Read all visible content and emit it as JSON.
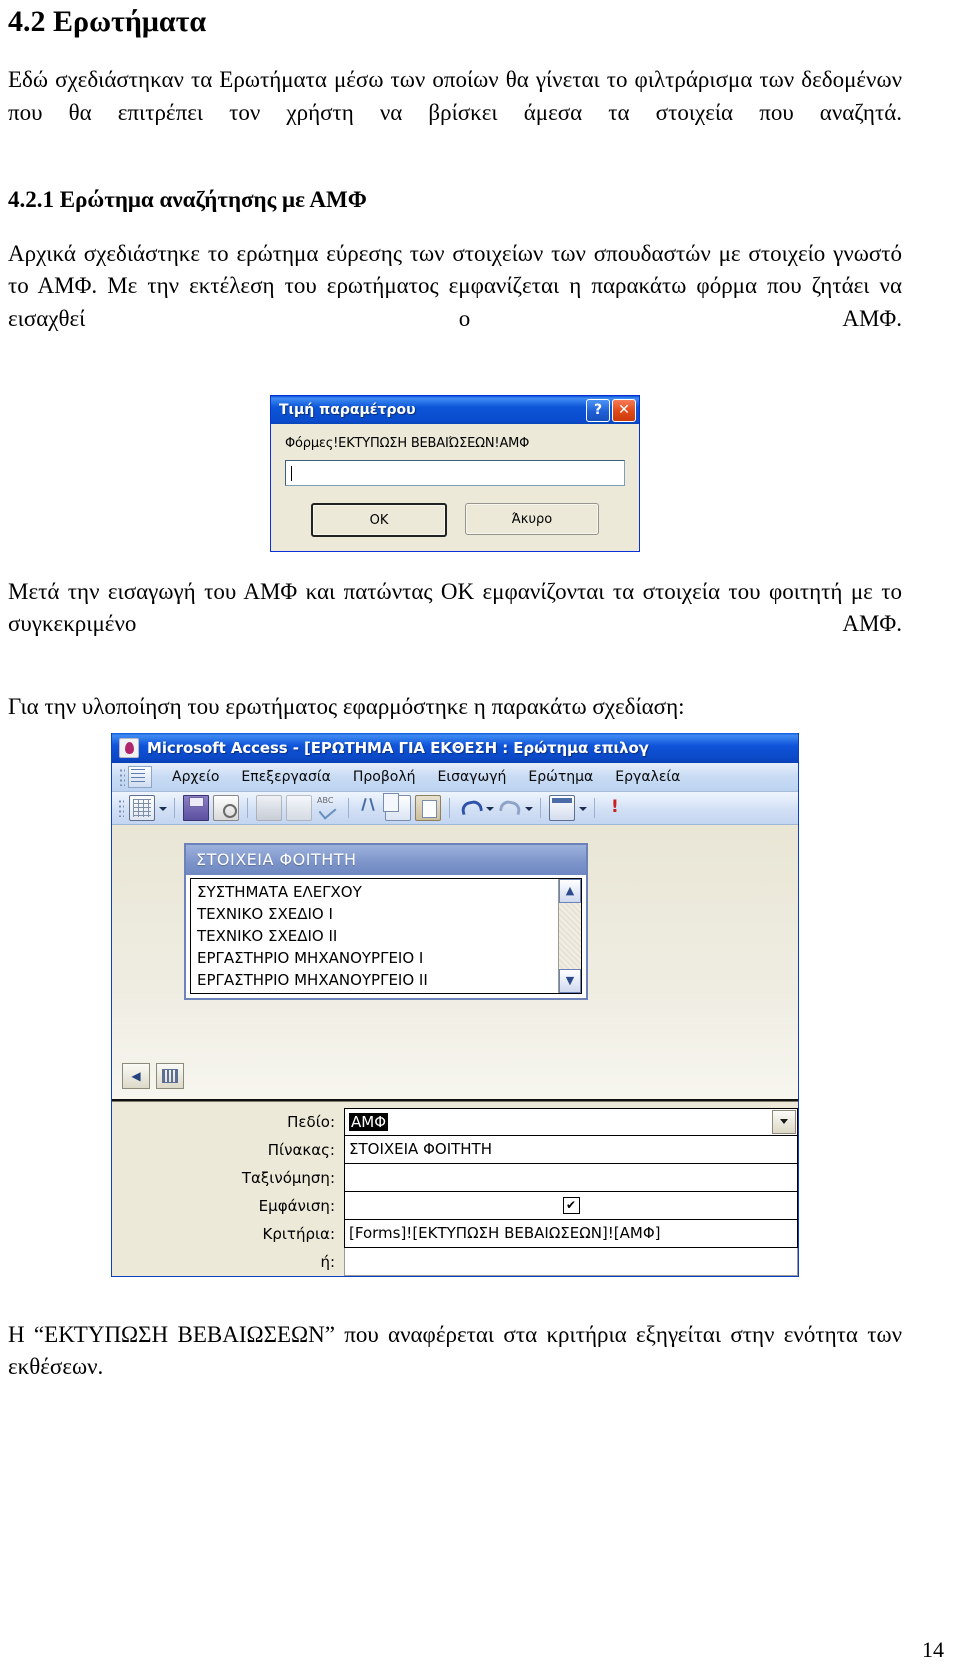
{
  "document": {
    "heading": "4.2 Ερωτήματα",
    "intro_paragraph": "Εδώ σχεδιάστηκαν τα Ερωτήματα μέσω των οποίων θα γίνεται το φιλτράρισμα των δεδομένων που θα επιτρέπει τον χρήστη να βρίσκει άμεσα τα στοιχεία που αναζητά.",
    "subheading": "4.2.1 Ερώτημα αναζήτησης με ΑΜΦ",
    "paragraph_2": "Αρχικά σχεδιάστηκε το ερώτημα εύρεσης των στοιχείων των σπουδαστών με στοιχείο γνωστό το ΑΜΦ. Με την εκτέλεση του ερωτήματος εμφανίζεται η παρακάτω φόρμα που ζητάει να εισαχθεί ο ΑΜΦ.",
    "paragraph_3": "Μετά την εισαγωγή του ΑΜΦ και πατώντας ΟΚ εμφανίζονται τα στοιχεία του φοιτητή με το συγκεκριμένο ΑΜΦ.",
    "paragraph_4": "Για την υλοποίηση του ερωτήματος εφαρμόστηκε η παρακάτω σχεδίαση:",
    "paragraph_5": "Η “ΕΚΤΥΠΩΣΗ ΒΕΒΑΙΩΣΕΩΝ” που αναφέρεται στα κριτήρια εξηγείται στην ενότητα των εκθέσεων.",
    "page_number": "14"
  },
  "parameter_dialog": {
    "title": "Τιμή παραμέτρου",
    "help_icon": "?",
    "close_icon": "✕",
    "prompt": "Φόρμες!ΕΚΤΥΠΩΣΗ ΒΕΒΑΙΏΣΕΩΝ!ΑΜΦ",
    "input_value": "",
    "ok_label": "OK",
    "cancel_label": "Άκυρο"
  },
  "access_window": {
    "title": "Microsoft Access - [ΕΡΩΤΗΜΑ ΓΙΑ ΕΚΘΕΣΗ : Ερώτημα επιλογ",
    "menu": [
      {
        "label": "Αρχείο"
      },
      {
        "label": "Επεξεργασία"
      },
      {
        "label": "Προβολή"
      },
      {
        "label": "Εισαγωγή"
      },
      {
        "label": "Ερώτημα"
      },
      {
        "label": "Εργαλεία"
      }
    ],
    "toolbar_icons": [
      "view-datasheet-icon",
      "view-dropdown-icon",
      "save-icon",
      "search-file-icon",
      "print-icon",
      "print-preview-icon",
      "spelling-icon",
      "cut-icon",
      "copy-icon",
      "paste-icon",
      "undo-icon",
      "undo-dropdown-icon",
      "redo-icon",
      "redo-dropdown-icon",
      "show-table-icon",
      "show-table-dropdown-icon",
      "run-query-icon"
    ],
    "table_box": {
      "title": "ΣΤΟΙΧΕΙΑ ΦΟΙΤΗΤΗ",
      "fields": [
        "ΣΥΣΤΗΜΑΤΑ ΕΛΕΓΧΟΥ",
        "ΤΕΧΝΙΚΟ ΣΧΕΔΙΟ Ι",
        "ΤΕΧΝΙΚΟ ΣΧΕΔΙΟ ΙΙ",
        "ΕΡΓΑΣΤΗΡΙΟ ΜΗΧΑΝΟΥΡΓΕΙΟ Ι",
        "ΕΡΓΑΣΤΗΡΙΟ ΜΗΧΑΝΟΥΡΓΕΙΟ ΙΙ"
      ],
      "scroll_up_icon": "▲",
      "scroll_down_icon": "▼"
    },
    "canvas_tools": [
      "back-arrow-icon",
      "grid-icon"
    ],
    "design_grid": [
      {
        "label": "Πεδίο:",
        "value": "ΑΜΦ",
        "type": "selected-dropdown"
      },
      {
        "label": "Πίνακας:",
        "value": "ΣΤΟΙΧΕΙΑ ΦΟΙΤΗΤΗ",
        "type": "text"
      },
      {
        "label": "Ταξινόμηση:",
        "value": "",
        "type": "text"
      },
      {
        "label": "Εμφάνιση:",
        "value": "✔",
        "type": "checkbox"
      },
      {
        "label": "Κριτήρια:",
        "value": "[Forms]![ΕΚΤΥΠΩΣΗ ΒΕΒΑΙΩΣΕΩΝ]![ΑΜΦ]",
        "type": "text"
      },
      {
        "label": "ή:",
        "value": "",
        "type": "text"
      }
    ]
  }
}
